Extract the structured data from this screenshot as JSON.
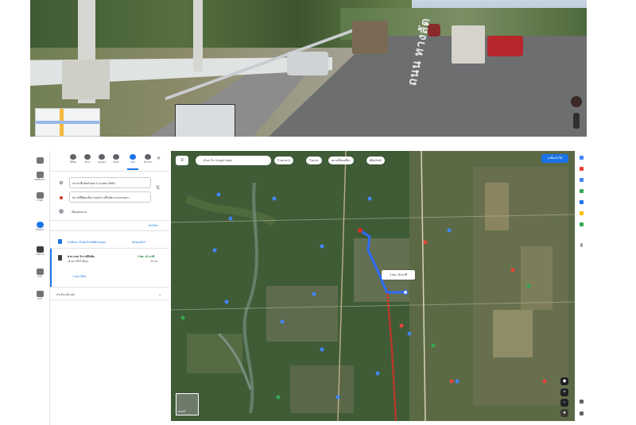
{
  "street_view": {
    "lane_label": "ถนน ทางลัด",
    "compass_icon": "compass-icon",
    "exit_icon": "close-icon"
  },
  "sidebar_rail": {
    "items": [
      {
        "icon": "menu-icon",
        "label": ""
      },
      {
        "icon": "bookmark-icon",
        "label": "บันทึกแล้ว"
      },
      {
        "icon": "history-icon",
        "label": "ล่าสุด"
      },
      {
        "icon": "directions-icon",
        "label": "เส้นทาง"
      },
      {
        "icon": "photo-icon",
        "label": "ภาพถ่าย"
      },
      {
        "icon": "share-icon",
        "label": "แชร์"
      },
      {
        "icon": "apps-icon",
        "label": "แอป"
      }
    ]
  },
  "directions": {
    "modes": [
      {
        "icon": "best-route-icon",
        "label": "ดีที่สุด"
      },
      {
        "icon": "car-icon",
        "label": "ขับรถ"
      },
      {
        "icon": "motorcycle-icon",
        "label": "มอเตอร์"
      },
      {
        "icon": "transit-icon",
        "label": "ขนส่ง"
      },
      {
        "icon": "walk-icon",
        "label": "เดิน"
      },
      {
        "icon": "bicycle-icon",
        "label": "จักรยาน"
      }
    ],
    "origin": "ประชาชื่นทิปส์ ซอย 4 กรุงเทพ 10800",
    "destination": "สถานที่ที่คุณเลือก ถนนวิภาวดีรังสิต แขวงลาดยาว",
    "add_stop": "เพิ่มจุดหมาย",
    "options_label": "ตัวเลือก",
    "send_label": "ส่งเส้นทางไปยังโทรศัพท์ของคุณ",
    "copy_link": "คัดลอกลิงก์",
    "route_title": "ผ่าน ถนน วิภาวดีรังสิต",
    "route_subtitle": "เส้นทางที่เร็วที่สุด",
    "route_time": "1 ชม. 10 นาที",
    "route_distance": "43 กม.",
    "details_link": "รายละเอียด",
    "more_section": "ตัวเลือกเพิ่มเติม"
  },
  "map": {
    "search_placeholder": "ค้นหาใน Google Maps",
    "chips": [
      "ร้านอาหาร",
      "โรงแรม",
      "สถานที่ท่องเที่ยว",
      "พิพิธภัณฑ์"
    ],
    "sign_in": "ลงชื่อเข้าใช้",
    "route_badge": "1 ชม. 10 นาที",
    "layers_label": "เลเยอร์",
    "zoom_in": "+",
    "zoom_out": "−",
    "colors": {
      "route": "#2f6bff",
      "traffic": "#d93025",
      "sign_in": "#1a73e8"
    }
  }
}
